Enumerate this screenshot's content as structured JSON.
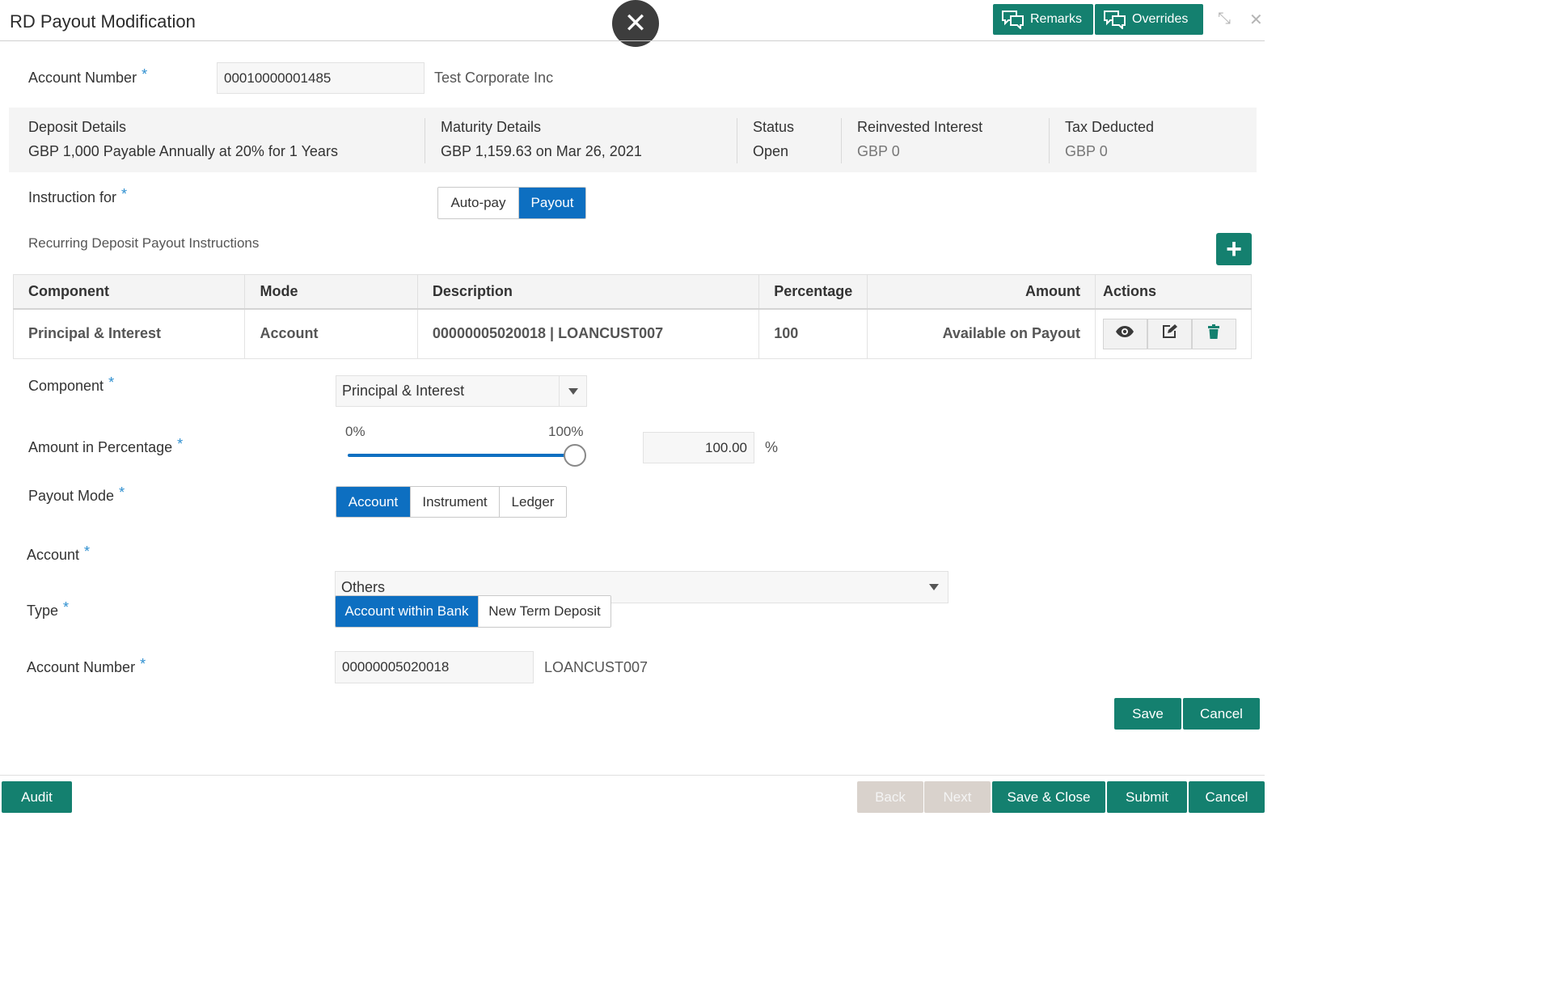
{
  "header": {
    "title": "RD Payout Modification",
    "remarks_label": "Remarks",
    "overrides_label": "Overrides",
    "close_glyph": "✕",
    "minimize_glyph": "⤡",
    "window_close_glyph": "✕"
  },
  "account": {
    "label": "Account Number",
    "value": "00010000001485",
    "name": "Test Corporate Inc"
  },
  "details": {
    "deposit_label": "Deposit Details",
    "deposit_value": "GBP 1,000 Payable Annually at 20% for 1 Years",
    "maturity_label": "Maturity Details",
    "maturity_value": "GBP 1,159.63 on Mar 26, 2021",
    "status_label": "Status",
    "status_value": "Open",
    "reinvested_label": "Reinvested Interest",
    "reinvested_value": "GBP 0",
    "tax_label": "Tax Deducted",
    "tax_value": "GBP 0"
  },
  "instruction": {
    "label": "Instruction for",
    "options": [
      "Auto-pay",
      "Payout"
    ],
    "selected": "Payout"
  },
  "section_title": "Recurring Deposit Payout Instructions",
  "table": {
    "headers": [
      "Component",
      "Mode",
      "Description",
      "Percentage",
      "Amount",
      "Actions"
    ],
    "rows": [
      {
        "component": "Principal & Interest",
        "mode": "Account",
        "description": "00000005020018 | LOANCUST007",
        "percentage": "100",
        "amount": "Available on Payout"
      }
    ]
  },
  "form": {
    "component_label": "Component",
    "component_value": "Principal & Interest",
    "amount_label": "Amount in Percentage",
    "slider_min_label": "0%",
    "slider_max_label": "100%",
    "slider_level_percent": 100,
    "amount_value": "100.00",
    "amount_unit": "%",
    "payout_mode_label": "Payout Mode",
    "payout_mode_options": [
      "Account",
      "Instrument",
      "Ledger"
    ],
    "payout_mode_selected": "Account",
    "account_label": "Account",
    "account_value": "Others",
    "type_label": "Type",
    "type_options": [
      "Account within Bank",
      "New Term Deposit"
    ],
    "type_selected": "Account within Bank",
    "account_number_label": "Account Number",
    "account_number_value": "00000005020018",
    "account_number_name": "LOANCUST007",
    "save_label": "Save",
    "cancel_label": "Cancel"
  },
  "footer": {
    "audit_label": "Audit",
    "back_label": "Back",
    "next_label": "Next",
    "save_close_label": "Save & Close",
    "submit_label": "Submit",
    "cancel_label": "Cancel"
  },
  "colors": {
    "teal": "#14806f",
    "blue": "#0d6fc1",
    "required": "#2e8fd0"
  }
}
